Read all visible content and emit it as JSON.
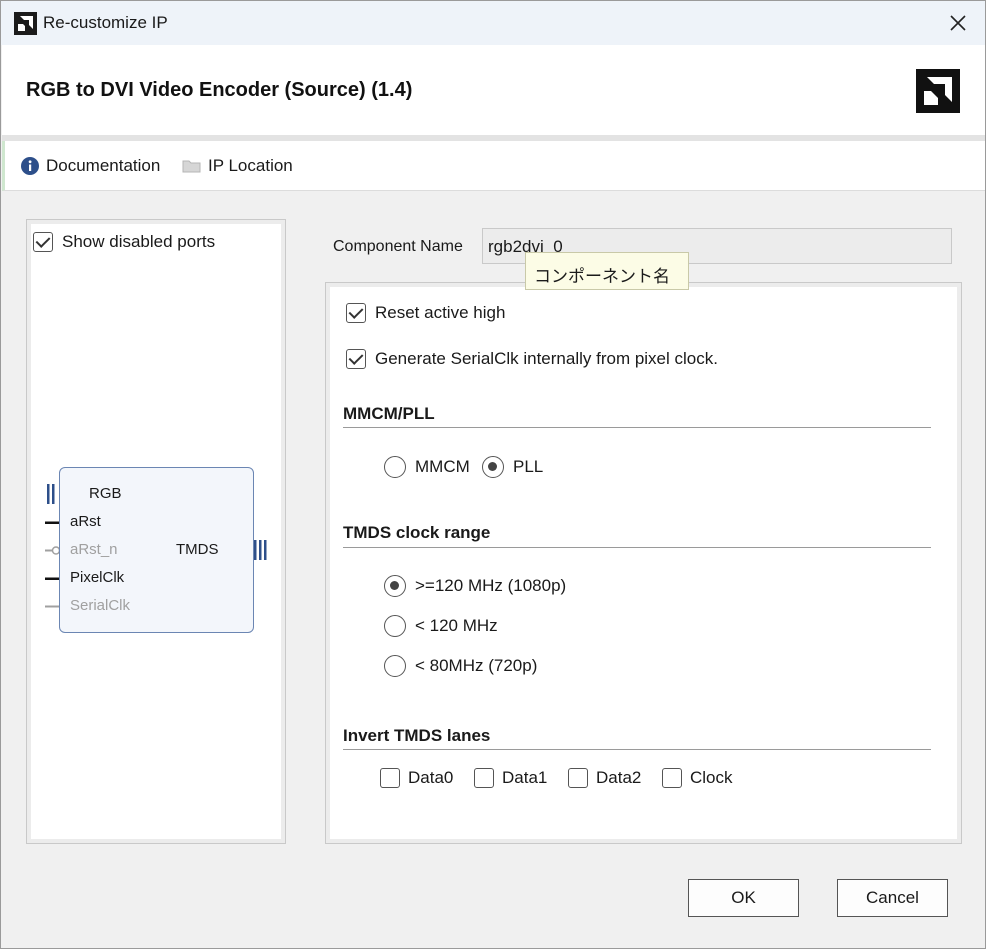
{
  "window": {
    "title": "Re-customize IP",
    "close_icon": "close-icon"
  },
  "header": {
    "ip_title": "RGB to DVI Video Encoder (Source) (1.4)",
    "logo_icon": "amd-logo-icon"
  },
  "links": {
    "documentation": "Documentation",
    "ip_location": "IP Location"
  },
  "left_panel": {
    "show_disabled_ports_label": "Show disabled ports",
    "show_disabled_ports_checked": true,
    "block": {
      "inputs": [
        {
          "label": "RGB",
          "type": "bus",
          "enabled": true
        },
        {
          "label": "aRst",
          "type": "wire",
          "enabled": true
        },
        {
          "label": "aRst_n",
          "type": "wire-inverted",
          "enabled": false
        },
        {
          "label": "PixelClk",
          "type": "wire",
          "enabled": true
        },
        {
          "label": "SerialClk",
          "type": "wire",
          "enabled": false
        }
      ],
      "outputs": [
        {
          "label": "TMDS",
          "type": "bus",
          "enabled": true
        }
      ]
    }
  },
  "component": {
    "label": "Component Name",
    "value": "rgb2dvi_0",
    "tooltip": "コンポーネント名"
  },
  "options": {
    "reset_active_high": {
      "label": "Reset active high",
      "checked": true
    },
    "gen_serialclk": {
      "label": "Generate SerialClk internally from pixel clock.",
      "checked": true
    }
  },
  "mmcm_pll": {
    "title": "MMCM/PLL",
    "options": [
      {
        "label": "MMCM",
        "selected": false
      },
      {
        "label": "PLL",
        "selected": true
      }
    ]
  },
  "tmds_clock_range": {
    "title": "TMDS clock range",
    "options": [
      {
        "label": ">=120 MHz (1080p)",
        "selected": true
      },
      {
        "label": "< 120 MHz",
        "selected": false
      },
      {
        "label": "< 80MHz (720p)",
        "selected": false
      }
    ]
  },
  "invert_tmds_lanes": {
    "title": "Invert TMDS lanes",
    "lanes": [
      {
        "label": "Data0",
        "checked": false
      },
      {
        "label": "Data1",
        "checked": false
      },
      {
        "label": "Data2",
        "checked": false
      },
      {
        "label": "Clock",
        "checked": false
      }
    ]
  },
  "buttons": {
    "ok": "OK",
    "cancel": "Cancel"
  },
  "colors": {
    "block_border": "#6b86b3",
    "bus_icon": "#2d4f8a",
    "info_icon": "#2d4f8a",
    "disabled_text": "#a0a0a0"
  }
}
